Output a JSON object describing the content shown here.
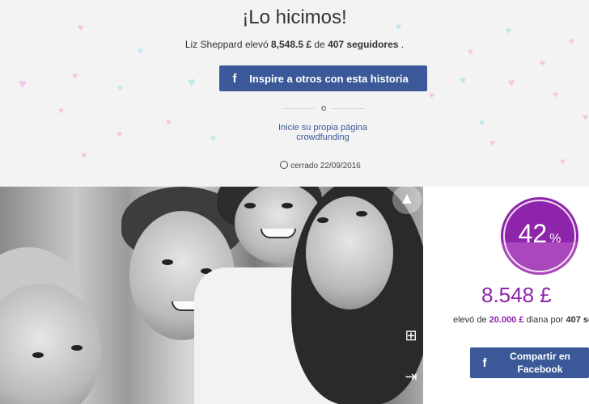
{
  "hero": {
    "title": "¡Lo hicimos!",
    "organizer": "Liz Sheppard",
    "raised_verb": "elevó",
    "raised_amount": "8,548.5 £",
    "of": "de",
    "supporters": "407 seguidores",
    "period": ".",
    "inspire_button": "Inspire a otros con esta historia",
    "or": "o",
    "start_link_line1": "Inicie su propia página",
    "start_link_line2": "crowdfunding",
    "closed_text": "cerrado 22/09/2016"
  },
  "stats": {
    "percent": "42",
    "percent_sign": "%",
    "progress": 0.42,
    "amount": "8.548 £",
    "goal_prefix": "elevó de",
    "goal_amount": "20.000 £",
    "goal_mid": "diana por",
    "goal_count": "407 se",
    "share_button_line1": "Compartir en",
    "share_button_line2": "Facebook"
  },
  "icons": {
    "facebook": "facebook-icon",
    "clock": "clock-icon",
    "navigate": "navigation-arrow-icon",
    "add": "add-to-list-icon",
    "login": "login-icon"
  },
  "colors": {
    "facebook_blue": "#3b5998",
    "accent_purple": "#8e24aa",
    "link_blue": "#3b5998"
  }
}
